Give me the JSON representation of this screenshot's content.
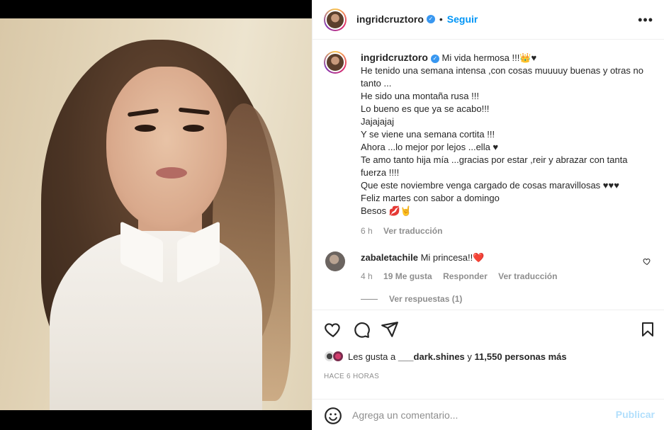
{
  "post": {
    "author": "ingridcruztoro",
    "follow_label": "Seguir",
    "more_icon": "more-horizontal-icon"
  },
  "caption": {
    "author": "ingridcruztoro",
    "lines": [
      "Mi vida hermosa !!!👑♥",
      "He tenido una semana intensa ,con cosas muuuuy buenas y otras no tanto ...",
      "He sido una montaña rusa !!!",
      "Lo bueno es que ya se acabo!!!",
      "Jajajajaj",
      "Y se viene una semana cortita !!!",
      "Ahora ...lo mejor por lejos ...ella ♥",
      "Te amo tanto hija mía ...gracias por estar ,reir y abrazar con tanta fuerza !!!!",
      "Que este noviembre venga cargado de cosas maravillosas ♥♥♥",
      "Feliz martes con sabor a domingo",
      "Besos 💋🤘"
    ],
    "time": "6 h",
    "translate": "Ver traducción"
  },
  "comment": {
    "author": "zabaletachile",
    "text": "Mi princesa!!❤️",
    "time": "4 h",
    "likes": "19 Me gusta",
    "reply": "Responder",
    "translate": "Ver traducción",
    "view_replies": "Ver respuestas (1)"
  },
  "likes": {
    "prefix": "Les gusta a",
    "user": "___dark.shines",
    "middle": "y",
    "count": "11,550 personas más"
  },
  "timestamp": "HACE 6 HORAS",
  "add_comment": {
    "placeholder": "Agrega un comentario...",
    "publish": "Publicar"
  },
  "colors": {
    "accent": "#0095f6",
    "verified": "#3897f0",
    "muted": "#8e8e8e",
    "publish_disabled": "#b2dffc",
    "heart_red": "#ed4956"
  }
}
